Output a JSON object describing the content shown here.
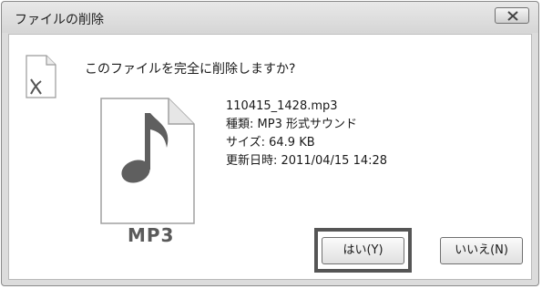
{
  "window": {
    "title": "ファイルの削除"
  },
  "dialog": {
    "question": "このファイルを完全に削除しますか?",
    "file_badge": "MP3",
    "details": {
      "file_name": "110415_1428.mp3",
      "type_line": "種類: MP3 形式サウンド",
      "size_line": "サイズ: 64.9 KB",
      "modified_line": "更新日時: 2011/04/15 14:28"
    }
  },
  "buttons": {
    "yes_label": "はい(Y)",
    "no_label": "いいえ(N)"
  },
  "icons": {
    "close": "close-icon",
    "small_file": "deleted-file-icon",
    "big_file": "mp3-file-icon"
  }
}
